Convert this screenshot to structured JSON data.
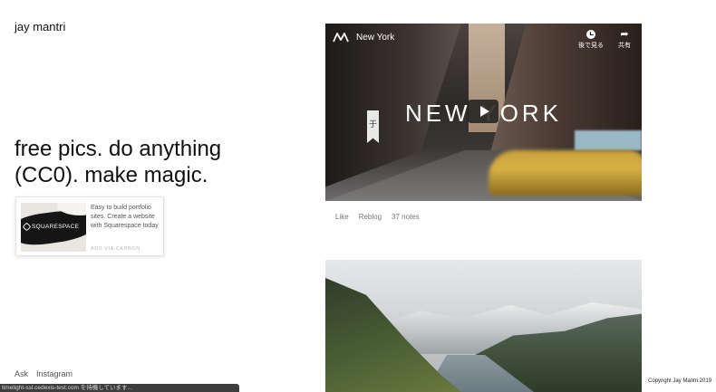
{
  "site": {
    "title": "jay mantri",
    "tagline": "free pics. do anything (CC0). make magic."
  },
  "ad": {
    "brand": "SQUARESPACE",
    "text": "Easy to build portfolio sites. Create a website with Squarespace today",
    "via": "ADS VIA CARBON"
  },
  "footer": {
    "links": [
      "Ask",
      "Instagram"
    ],
    "copyright": "Copyright Jay Mantri 2019"
  },
  "status_bar": "timelight-ssl.cedexis-test.com を待機しています...",
  "video_post": {
    "channel": "New York",
    "overlay_title": "NEW YORK",
    "watch_later": "後で見る",
    "share": "共有",
    "banner_glyph": "于"
  },
  "post_meta": {
    "like": "Like",
    "reblog": "Reblog",
    "notes": "37 notes"
  },
  "icons": {
    "video_logo": "vimeo-like-m-icon",
    "watch_later": "clock-icon",
    "share": "share-arrow-icon",
    "play": "play-icon"
  }
}
